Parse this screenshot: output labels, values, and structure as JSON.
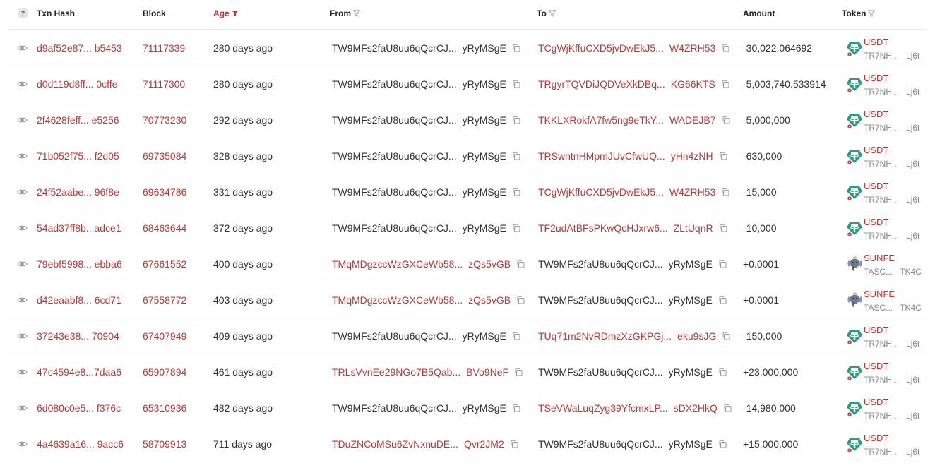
{
  "header": {
    "help_glyph": "?",
    "txn_hash": "Txn Hash",
    "block": "Block",
    "age": "Age",
    "from": "From",
    "to": "To",
    "amount": "Amount",
    "token": "Token"
  },
  "colors": {
    "accent": "#c23631",
    "usdt": "#26a17b",
    "border": "#ececec"
  },
  "rows": [
    {
      "hash": "d9af52e87... b5453",
      "block": "71117339",
      "age": "280 days ago",
      "from_a": "TW9MFs2faU8uu6qQcrCJ...",
      "from_b": "yRyMSgE",
      "from_red": false,
      "to_a": "TCgWjKffuCXD5jvDwEkJ5...",
      "to_b": "W4ZRH53",
      "to_red": true,
      "amount": "-30,022.064692",
      "token_symbol": "USDT",
      "token_sub_a": "TR7NH...",
      "token_sub_b": "Lj6t",
      "token_icon": "usdt-icon"
    },
    {
      "hash": "d0d119d8ff... 0cffe",
      "block": "71117300",
      "age": "280 days ago",
      "from_a": "TW9MFs2faU8uu6qQcrCJ...",
      "from_b": "yRyMSgE",
      "from_red": false,
      "to_a": "TRgyrTQVDiJQDVeXkDBq...",
      "to_b": "KG66KTS",
      "to_red": true,
      "amount": "-5,003,740.533914",
      "token_symbol": "USDT",
      "token_sub_a": "TR7NH...",
      "token_sub_b": "Lj6t",
      "token_icon": "usdt-icon"
    },
    {
      "hash": "2f4628feff... e5256",
      "block": "70773230",
      "age": "292 days ago",
      "from_a": "TW9MFs2faU8uu6qQcrCJ...",
      "from_b": "yRyMSgE",
      "from_red": false,
      "to_a": "TKKLXRokfA7fw5ng9eTkY...",
      "to_b": "WADEJB7",
      "to_red": true,
      "amount": "-5,000,000",
      "token_symbol": "USDT",
      "token_sub_a": "TR7NH...",
      "token_sub_b": "Lj6t",
      "token_icon": "usdt-icon"
    },
    {
      "hash": "71b052f75... f2d05",
      "block": "69735084",
      "age": "328 days ago",
      "from_a": "TW9MFs2faU8uu6qQcrCJ...",
      "from_b": "yRyMSgE",
      "from_red": false,
      "to_a": "TRSwntnHMpmJUvCfwUQ...",
      "to_b": "yHn4zNH",
      "to_red": true,
      "amount": "-630,000",
      "token_symbol": "USDT",
      "token_sub_a": "TR7NH...",
      "token_sub_b": "Lj6t",
      "token_icon": "usdt-icon"
    },
    {
      "hash": "24f52aabe... 96f8e",
      "block": "69634786",
      "age": "331 days ago",
      "from_a": "TW9MFs2faU8uu6qQcrCJ...",
      "from_b": "yRyMSgE",
      "from_red": false,
      "to_a": "TCgWjKffuCXD5jvDwEkJ5...",
      "to_b": "W4ZRH53",
      "to_red": true,
      "amount": "-15,000",
      "token_symbol": "USDT",
      "token_sub_a": "TR7NH...",
      "token_sub_b": "Lj6t",
      "token_icon": "usdt-icon"
    },
    {
      "hash": "54ad37ff8b...adce1",
      "block": "68463644",
      "age": "372 days ago",
      "from_a": "TW9MFs2faU8uu6qQcrCJ...",
      "from_b": "yRyMSgE",
      "from_red": false,
      "to_a": "TF2udAtBFsPKwQcHJxrw6...",
      "to_b": "ZLtUqnR",
      "to_red": true,
      "amount": "-10,000",
      "token_symbol": "USDT",
      "token_sub_a": "TR7NH...",
      "token_sub_b": "Lj6t",
      "token_icon": "usdt-icon"
    },
    {
      "hash": "79ebf5998... ebba6",
      "block": "67661552",
      "age": "400 days ago",
      "from_a": "TMqMDgzccWzGXCeWb58...",
      "from_b": "zQs5vGB",
      "from_red": true,
      "to_a": "TW9MFs2faU8uu6qQcrCJ...",
      "to_b": "yRyMSgE",
      "to_red": false,
      "amount": "+0.0001",
      "token_symbol": "SUNFE",
      "token_sub_a": "TASC...",
      "token_sub_b": "TK4C",
      "token_icon": "elephant-icon"
    },
    {
      "hash": "d42eaabf8... 6cd71",
      "block": "67558772",
      "age": "403 days ago",
      "from_a": "TMqMDgzccWzGXCeWb58...",
      "from_b": "zQs5vGB",
      "from_red": true,
      "to_a": "TW9MFs2faU8uu6qQcrCJ...",
      "to_b": "yRyMSgE",
      "to_red": false,
      "amount": "+0.0001",
      "token_symbol": "SUNFE",
      "token_sub_a": "TASC...",
      "token_sub_b": "TK4C",
      "token_icon": "elephant-icon"
    },
    {
      "hash": "37243e38... 70904",
      "block": "67407949",
      "age": "409 days ago",
      "from_a": "TW9MFs2faU8uu6qQcrCJ...",
      "from_b": "yRyMSgE",
      "from_red": false,
      "to_a": "TUq71m2NvRDmzXzGKPGj...",
      "to_b": "eku9sJG",
      "to_red": true,
      "amount": "-150,000",
      "token_symbol": "USDT",
      "token_sub_a": "TR7NH...",
      "token_sub_b": "Lj6t",
      "token_icon": "usdt-icon"
    },
    {
      "hash": "47c4594e8...7daa6",
      "block": "65907894",
      "age": "461 days ago",
      "from_a": "TRLsVvnEe29NGo7B5Qab...",
      "from_b": "BVo9NeF",
      "from_red": true,
      "to_a": "TW9MFs2faU8uu6qQcrCJ...",
      "to_b": "yRyMSgE",
      "to_red": false,
      "amount": "+23,000,000",
      "token_symbol": "USDT",
      "token_sub_a": "TR7NH...",
      "token_sub_b": "Lj6t",
      "token_icon": "usdt-icon"
    },
    {
      "hash": "6d080c0e5... f376c",
      "block": "65310936",
      "age": "482 days ago",
      "from_a": "TW9MFs2faU8uu6qQcrCJ...",
      "from_b": "yRyMSgE",
      "from_red": false,
      "to_a": "TSeVWaLuqZyg39YfcmxLP...",
      "to_b": "sDX2HkQ",
      "to_red": true,
      "amount": "-14,980,000",
      "token_symbol": "USDT",
      "token_sub_a": "TR7NH...",
      "token_sub_b": "Lj6t",
      "token_icon": "usdt-icon"
    },
    {
      "hash": "4a4639a16... 9acc6",
      "block": "58709913",
      "age": "711 days ago",
      "from_a": "TDuZNCoMSu6ZvNxnuDE...",
      "from_b": "Qvr2JM2",
      "from_red": true,
      "to_a": "TW9MFs2faU8uu6qQcrCJ...",
      "to_b": "yRyMSgE",
      "to_red": false,
      "amount": "+15,000,000",
      "token_symbol": "USDT",
      "token_sub_a": "TR7NH...",
      "token_sub_b": "Lj6t",
      "token_icon": "usdt-icon"
    }
  ]
}
